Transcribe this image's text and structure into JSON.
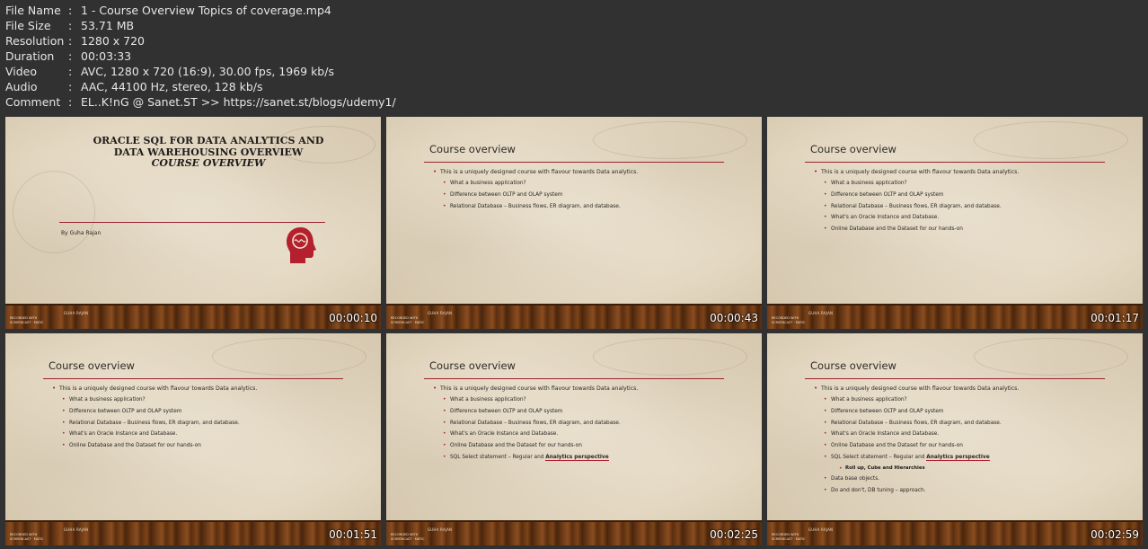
{
  "file_info": [
    {
      "key": "File Name",
      "value": "1 - Course Overview Topics of coverage.mp4"
    },
    {
      "key": "File Size",
      "value": "53.71 MB"
    },
    {
      "key": "Resolution",
      "value": "1280 x 720"
    },
    {
      "key": "Duration",
      "value": "00:03:33"
    },
    {
      "key": "Video",
      "value": "AVC, 1280 x 720 (16:9), 30.00 fps, 1969 kb/s"
    },
    {
      "key": "Audio",
      "value": "AAC, 44100 Hz, stereo, 128 kb/s"
    },
    {
      "key": "Comment",
      "value": "EL..K!nG @ Sanet.ST >> https://sanet.st/blogs/udemy1/"
    }
  ],
  "separator": ":",
  "footer": {
    "name": "GUHA RAJAN",
    "recorded_with": "RECORDED WITH",
    "brand": "SCREENCAST",
    "brand_suffix": "MATIC"
  },
  "cover": {
    "title_line1": "ORACLE SQL FOR DATA ANALYTICS AND",
    "title_line2": "DATA WAREHOUSING OVERVIEW",
    "title_line3": "COURSE OVERVIEW",
    "author": "By Guha Rajan"
  },
  "slide_title": "Course overview",
  "bullets": {
    "main": "This is a uniquely designed course with flavour towards Data analytics.",
    "biz": "What a business application?",
    "oltp": "Difference between OLTP and OLAP system",
    "rdb": "Relational Database – Business flows, ER diagram, and database.",
    "oracle": "What's an Oracle Instance and Database.",
    "online": "Online Database and the Dataset for our hands-on",
    "sql_prefix": "SQL Select statement – Regular and",
    "sql_highlight": "Analytics perspective",
    "rollup": "Roll up, Cube and Hierarchies",
    "dbobjects": "Data base objects.",
    "dodont": "Do and don't, DB tuning – approach."
  },
  "timestamps": [
    "00:00:10",
    "00:00:43",
    "00:01:17",
    "00:01:51",
    "00:02:25",
    "00:02:59"
  ],
  "colors": {
    "accent": "#9b2230",
    "background": "#313131",
    "slide_bg": "#e9dfcd"
  }
}
